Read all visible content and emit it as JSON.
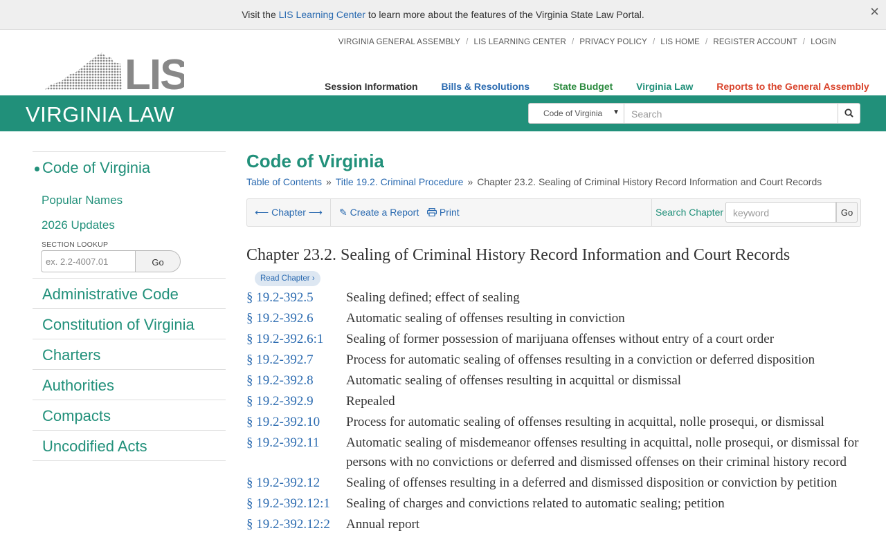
{
  "announcement": {
    "prefix": "Visit the ",
    "link": "LIS Learning Center",
    "suffix": " to learn more about the features of the Virginia State Law Portal.",
    "close_icon": "×"
  },
  "utility_nav": [
    "VIRGINIA GENERAL ASSEMBLY",
    "LIS LEARNING CENTER",
    "PRIVACY POLICY",
    "LIS HOME",
    "REGISTER ACCOUNT",
    "LOGIN"
  ],
  "utility_sep": "/",
  "main_nav": [
    {
      "label": "Session Information",
      "color": "#333333"
    },
    {
      "label": "Bills & Resolutions",
      "color": "#2a6ab0"
    },
    {
      "label": "State Budget",
      "color": "#2b8a3e"
    },
    {
      "label": "Virginia Law",
      "color": "#21907a"
    },
    {
      "label": "Reports to the General Assembly",
      "color": "#d9442c"
    }
  ],
  "logo": {
    "text": "LIS"
  },
  "banner": {
    "title": "VIRGINIA LAW",
    "scope_select": "Code of Virginia",
    "search_placeholder": "Search",
    "color": "#21907a"
  },
  "sidebar": {
    "active": "Code of Virginia",
    "sub_items": [
      "Popular Names",
      "2026 Updates"
    ],
    "lookup_label": "SECTION LOOKUP",
    "lookup_placeholder": "ex. 2.2-4007.01",
    "lookup_button": "Go",
    "items": [
      "Administrative Code",
      "Constitution of Virginia",
      "Charters",
      "Authorities",
      "Compacts",
      "Uncodified Acts"
    ]
  },
  "main": {
    "title": "Code of Virginia",
    "breadcrumb": {
      "links": [
        "Table of Contents",
        "Title 19.2. Criminal Procedure"
      ],
      "current": "Chapter 23.2. Sealing of Criminal History Record Information and Court Records",
      "sep": "»"
    },
    "toolbar": {
      "prev_arrow": "⟵",
      "chapter_label": "Chapter",
      "next_arrow": "⟶",
      "create_report": "Create a Report",
      "print": "Print",
      "search_label": "Search Chapter",
      "search_placeholder": "keyword",
      "search_button": "Go"
    },
    "chapter_heading": "Chapter 23.2. Sealing of Criminal History Record Information and Court Records",
    "read_chapter": "Read Chapter",
    "sections": [
      {
        "num": "§ 19.2-392.5",
        "title": "Sealing defined; effect of sealing"
      },
      {
        "num": "§ 19.2-392.6",
        "title": "Automatic sealing of offenses resulting in conviction"
      },
      {
        "num": "§ 19.2-392.6:1",
        "title": "Sealing of former possession of marijuana offenses without entry of a court order"
      },
      {
        "num": "§ 19.2-392.7",
        "title": "Process for automatic sealing of offenses resulting in a conviction or deferred disposition"
      },
      {
        "num": "§ 19.2-392.8",
        "title": "Automatic sealing of offenses resulting in acquittal or dismissal"
      },
      {
        "num": "§ 19.2-392.9",
        "title": "Repealed"
      },
      {
        "num": "§ 19.2-392.10",
        "title": "Process for automatic sealing of offenses resulting in acquittal, nolle prosequi, or dismissal"
      },
      {
        "num": "§ 19.2-392.11",
        "title": "Automatic sealing of misdemeanor offenses resulting in acquittal, nolle prosequi, or dismissal for persons with no convictions or deferred and dismissed offenses on their criminal history record"
      },
      {
        "num": "§ 19.2-392.12",
        "title": "Sealing of offenses resulting in a deferred and dismissed disposition or conviction by petition"
      },
      {
        "num": "§ 19.2-392.12:1",
        "title": "Sealing of charges and convictions related to automatic sealing; petition"
      },
      {
        "num": "§ 19.2-392.12:2",
        "title": "Annual report"
      }
    ]
  }
}
